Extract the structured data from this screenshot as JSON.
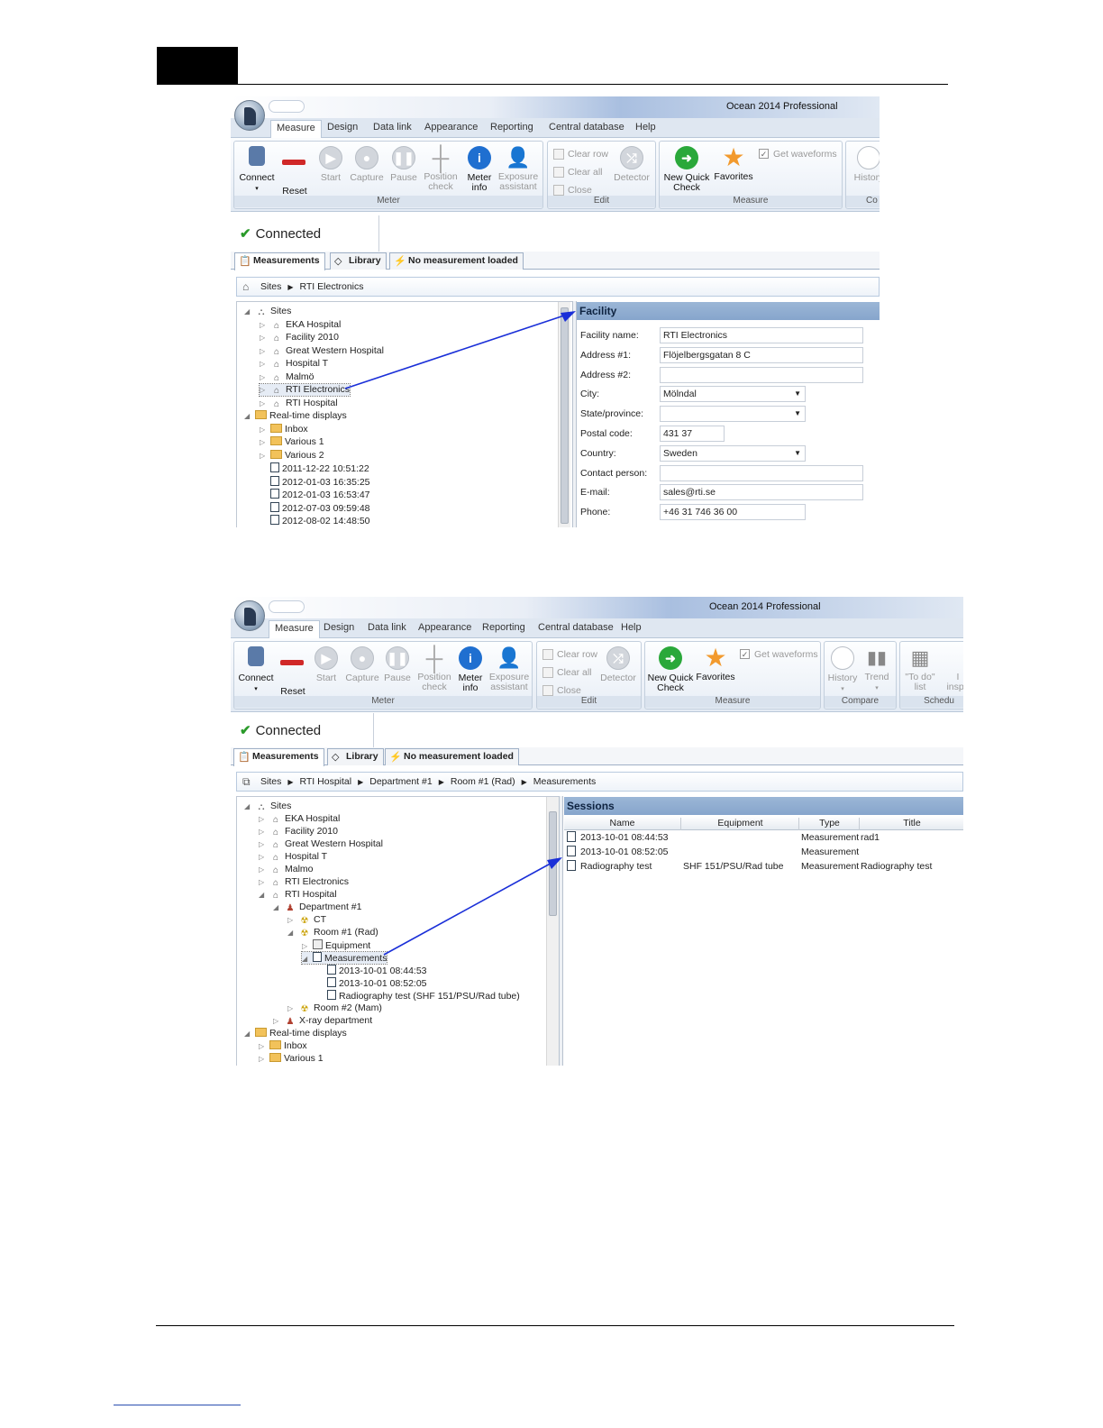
{
  "window_title": "Ocean 2014 Professional",
  "ribbon_tabs": [
    "Measure",
    "Design",
    "Data link",
    "Appearance",
    "Reporting",
    "Central database",
    "Help"
  ],
  "meter_group": {
    "label": "Meter",
    "buttons": [
      {
        "l1": "Connect",
        "l2": ""
      },
      {
        "l1": "Reset",
        "l2": ""
      },
      {
        "l1": "Start",
        "l2": ""
      },
      {
        "l1": "Capture",
        "l2": ""
      },
      {
        "l1": "Pause",
        "l2": ""
      },
      {
        "l1": "Position",
        "l2": "check"
      },
      {
        "l1": "Meter",
        "l2": "info"
      },
      {
        "l1": "Exposure",
        "l2": "assistant"
      }
    ]
  },
  "edit_group": {
    "label": "Edit",
    "clear_row": "Clear row",
    "clear_all": "Clear all",
    "close": "Close",
    "detector": "Detector"
  },
  "measure_group": {
    "label": "Measure",
    "new_quick_l1": "New Quick",
    "new_quick_l2": "Check",
    "favorites": "Favorites",
    "get_waveforms": "Get waveforms"
  },
  "compare_group": {
    "label": "Compare",
    "history": "History",
    "trend": "Trend"
  },
  "schedule_group": {
    "label": "Schedu",
    "todo_l1": "\"To do\"",
    "todo_l2": "list",
    "insp_l1": "I",
    "insp_l2": "inspe"
  },
  "cut_group1": {
    "label": "Co",
    "history": "History"
  },
  "status_text": "Connected",
  "doc_tabs": {
    "measurements": "Measurements",
    "library": "Library",
    "no_measurement": "No measurement loaded"
  },
  "screen1": {
    "breadcrumb": [
      "Sites",
      "RTI Electronics"
    ],
    "tree": [
      {
        "t": "Sites",
        "lvl": 0,
        "ex": "◢",
        "ico": "sites"
      },
      {
        "t": "EKA Hospital",
        "lvl": 1,
        "ex": "▷",
        "ico": "house"
      },
      {
        "t": "Facility 2010",
        "lvl": 1,
        "ex": "▷",
        "ico": "house"
      },
      {
        "t": "Great Western Hospital",
        "lvl": 1,
        "ex": "▷",
        "ico": "house"
      },
      {
        "t": "Hospital T",
        "lvl": 1,
        "ex": "▷",
        "ico": "house"
      },
      {
        "t": "Malmö",
        "lvl": 1,
        "ex": "▷",
        "ico": "house"
      },
      {
        "t": "RTI Electronics",
        "lvl": 1,
        "ex": "▷",
        "ico": "house",
        "sel": true
      },
      {
        "t": "RTI Hospital",
        "lvl": 1,
        "ex": "▷",
        "ico": "house"
      },
      {
        "t": "Real-time displays",
        "lvl": 0,
        "ex": "◢",
        "ico": "folder"
      },
      {
        "t": "Inbox",
        "lvl": 1,
        "ex": "▷",
        "ico": "folder"
      },
      {
        "t": "Various 1",
        "lvl": 1,
        "ex": "▷",
        "ico": "folder"
      },
      {
        "t": "Various 2",
        "lvl": 1,
        "ex": "▷",
        "ico": "folder"
      },
      {
        "t": "2011-12-22 10:51:22",
        "lvl": 1,
        "ex": "",
        "ico": "doc"
      },
      {
        "t": "2012-01-03 16:35:25",
        "lvl": 1,
        "ex": "",
        "ico": "doc"
      },
      {
        "t": "2012-01-03 16:53:47",
        "lvl": 1,
        "ex": "",
        "ico": "doc"
      },
      {
        "t": "2012-07-03 09:59:48",
        "lvl": 1,
        "ex": "",
        "ico": "doc"
      },
      {
        "t": "2012-08-02 14:48:50",
        "lvl": 1,
        "ex": "",
        "ico": "doc"
      }
    ],
    "panel_title": "Facility",
    "form": [
      {
        "label": "Facility name:",
        "value": "RTI Electronics",
        "type": "text",
        "w": "wide"
      },
      {
        "label": "Address #1:",
        "value": "Flöjelbergsgatan 8 C",
        "type": "text",
        "w": "wide"
      },
      {
        "label": "Address #2:",
        "value": "",
        "type": "text",
        "w": "wide"
      },
      {
        "label": "City:",
        "value": "Mölndal",
        "type": "dropdown",
        "w": "mid"
      },
      {
        "label": "State/province:",
        "value": "",
        "type": "dropdown",
        "w": "mid"
      },
      {
        "label": "Postal code:",
        "value": "431 37",
        "type": "text",
        "w": "short"
      },
      {
        "label": "Country:",
        "value": "Sweden",
        "type": "dropdown",
        "w": "mid"
      },
      {
        "label": "Contact person:",
        "value": "",
        "type": "text",
        "w": "wide"
      },
      {
        "label": "E-mail:",
        "value": "sales@rti.se",
        "type": "text",
        "w": "wide"
      },
      {
        "label": "Phone:",
        "value": "+46 31 746 36 00",
        "type": "text",
        "w": "mid"
      }
    ]
  },
  "screen2": {
    "breadcrumb": [
      "Sites",
      "RTI Hospital",
      "Department #1",
      "Room #1 (Rad)",
      "Measurements"
    ],
    "tree": [
      {
        "t": "Sites",
        "lvl": 0,
        "ex": "◢",
        "ico": "sites"
      },
      {
        "t": "EKA Hospital",
        "lvl": 1,
        "ex": "▷",
        "ico": "house"
      },
      {
        "t": "Facility 2010",
        "lvl": 1,
        "ex": "▷",
        "ico": "house"
      },
      {
        "t": "Great Western Hospital",
        "lvl": 1,
        "ex": "▷",
        "ico": "house"
      },
      {
        "t": "Hospital T",
        "lvl": 1,
        "ex": "▷",
        "ico": "house"
      },
      {
        "t": "Malmo",
        "lvl": 1,
        "ex": "▷",
        "ico": "house"
      },
      {
        "t": "RTI Electronics",
        "lvl": 1,
        "ex": "▷",
        "ico": "house"
      },
      {
        "t": "RTI Hospital",
        "lvl": 1,
        "ex": "◢",
        "ico": "house"
      },
      {
        "t": "Department #1",
        "lvl": 2,
        "ex": "◢",
        "ico": "person"
      },
      {
        "t": "CT",
        "lvl": 3,
        "ex": "▷",
        "ico": "rad"
      },
      {
        "t": "Room #1 (Rad)",
        "lvl": 3,
        "ex": "◢",
        "ico": "rad"
      },
      {
        "t": "Equipment",
        "lvl": 4,
        "ex": "▷",
        "ico": "equip"
      },
      {
        "t": "Measurements",
        "lvl": 4,
        "ex": "◢",
        "ico": "doc",
        "sel": true
      },
      {
        "t": "2013-10-01 08:44:53",
        "lvl": 5,
        "ex": "",
        "ico": "doc"
      },
      {
        "t": "2013-10-01 08:52:05",
        "lvl": 5,
        "ex": "",
        "ico": "doc"
      },
      {
        "t": "Radiography test  (SHF 151/PSU/Rad tube)",
        "lvl": 5,
        "ex": "",
        "ico": "doc"
      },
      {
        "t": "Room #2 (Mam)",
        "lvl": 3,
        "ex": "▷",
        "ico": "rad"
      },
      {
        "t": "X-ray department",
        "lvl": 2,
        "ex": "▷",
        "ico": "person"
      },
      {
        "t": "Real-time displays",
        "lvl": 0,
        "ex": "◢",
        "ico": "folder"
      },
      {
        "t": "Inbox",
        "lvl": 1,
        "ex": "▷",
        "ico": "folder"
      },
      {
        "t": "Various 1",
        "lvl": 1,
        "ex": "▷",
        "ico": "folder"
      }
    ],
    "panel_title": "Sessions",
    "columns": [
      "Name",
      "Equipment",
      "Type",
      "Title"
    ],
    "rows": [
      {
        "name": "2013-10-01 08:44:53",
        "equipment": "",
        "type": "Measurement",
        "title": "rad1"
      },
      {
        "name": "2013-10-01 08:52:05",
        "equipment": "",
        "type": "Measurement",
        "title": ""
      },
      {
        "name": "Radiography test",
        "equipment": "SHF 151/PSU/Rad tube",
        "type": "Measurement",
        "title": "Radiography test"
      }
    ]
  },
  "colors": {
    "accent": "#1f6fd0",
    "panel_header": "#8fadd1",
    "arrow": "#1a2fd8",
    "connected_tick": "#2a9a2a"
  }
}
